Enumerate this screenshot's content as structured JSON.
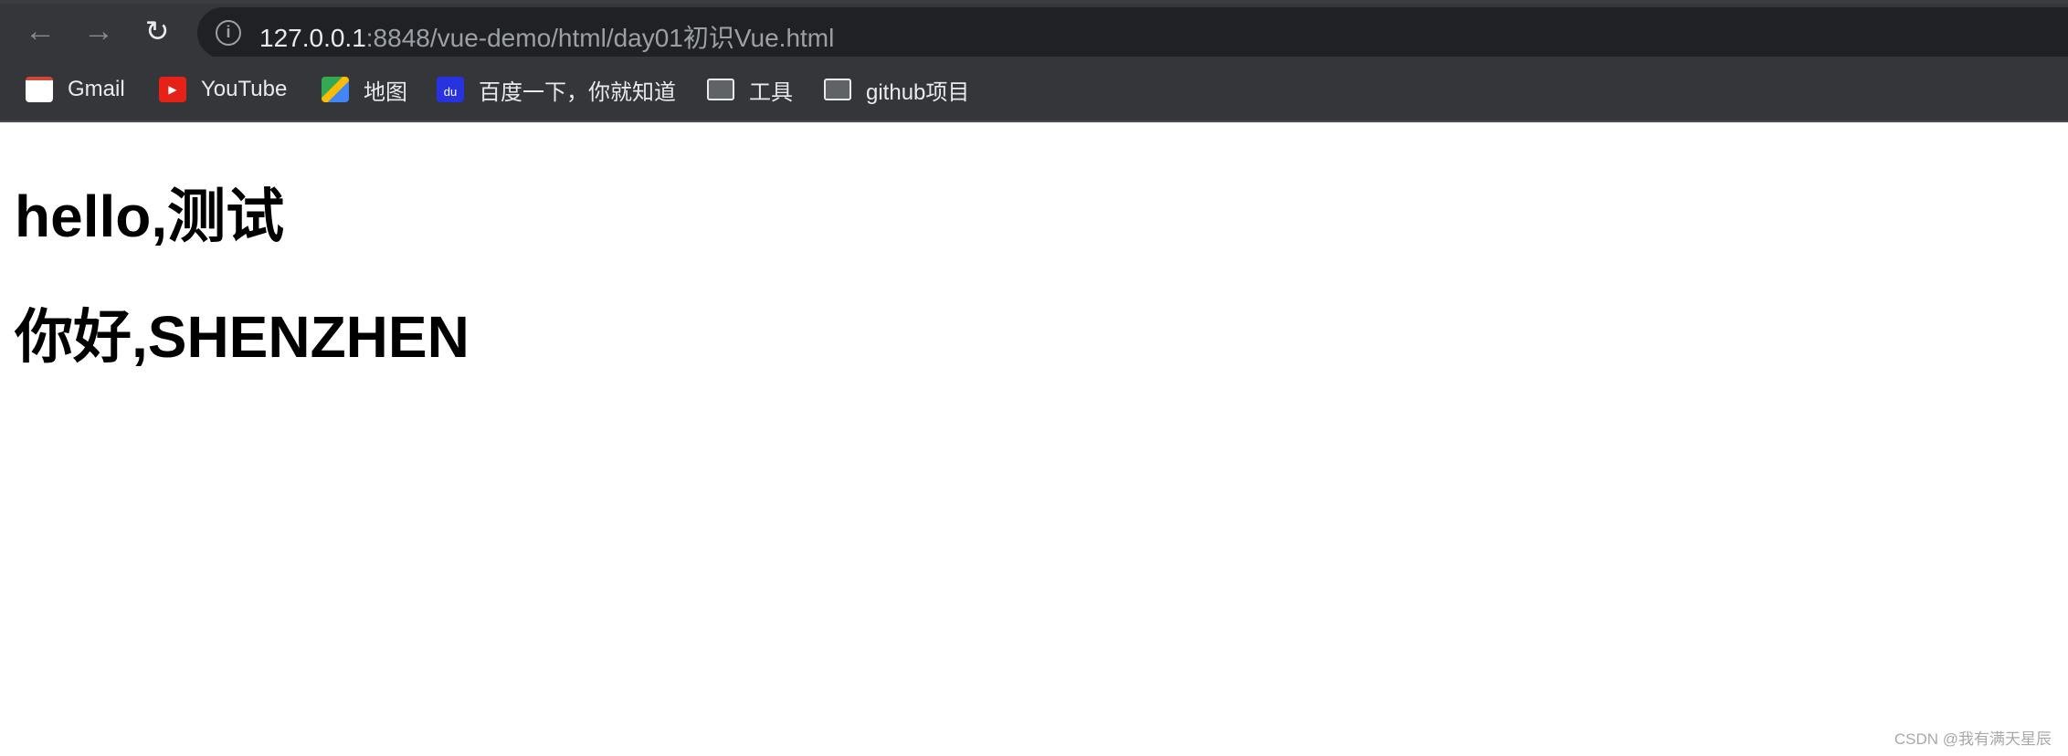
{
  "browser": {
    "url_host": "127.0.0.1",
    "url_rest": ":8848/vue-demo/html/day01初识Vue.html"
  },
  "bookmarks": [
    {
      "label": "Gmail",
      "icon": "gmail-icon",
      "color": "#d44638"
    },
    {
      "label": "YouTube",
      "icon": "youtube-icon",
      "color": "#ff0000"
    },
    {
      "label": "地图",
      "icon": "maps-icon",
      "color": "#34a853"
    },
    {
      "label": "百度一下，你就知道",
      "icon": "baidu-icon",
      "color": "#2932e1"
    },
    {
      "label": "工具",
      "icon": "folder-icon"
    },
    {
      "label": "github项目",
      "icon": "folder-icon"
    }
  ],
  "page": {
    "heading1": "hello,测试",
    "heading2": "你好,SHENZHEN"
  },
  "watermark": "CSDN @我有满天星辰"
}
